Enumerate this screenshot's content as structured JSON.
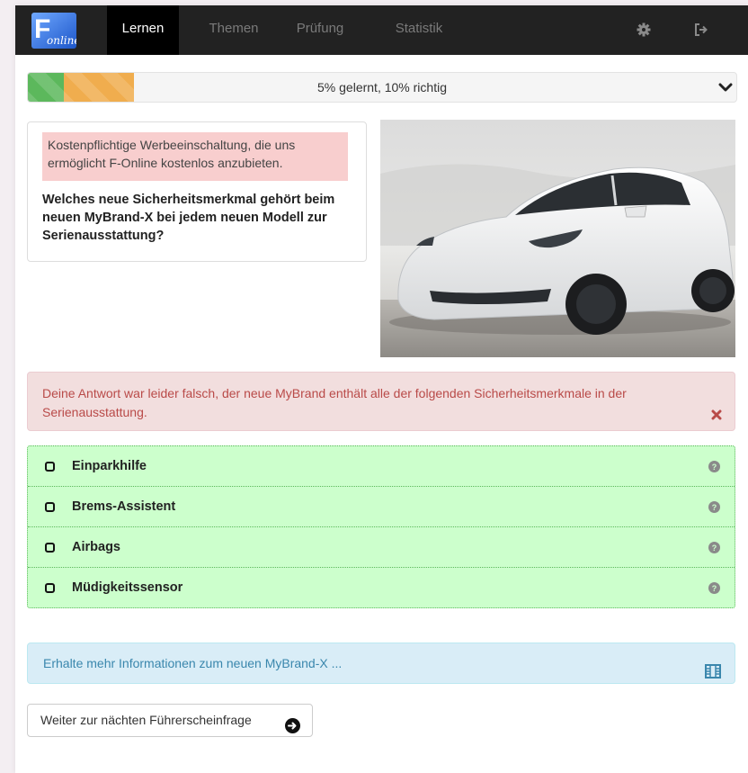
{
  "nav": {
    "logo_letter": "F",
    "logo_sub": "online",
    "items": [
      {
        "label": "Lernen",
        "active": true
      },
      {
        "label": "Themen",
        "active": false
      },
      {
        "label": "Prüfung",
        "active": false
      },
      {
        "label": "Statistik",
        "active": false
      }
    ],
    "icons": [
      "gear-icon",
      "sign-out-icon"
    ]
  },
  "progress": {
    "text": "5% gelernt, 10% richtig",
    "learned_percent": 5,
    "correct_percent": 10
  },
  "question": {
    "ad_text": "Kostenpflichtige Werbeeinschaltung, die uns ermöglicht F-Online kostenlos anzubieten.",
    "text": "Welches neue Sicherheitsmerkmal gehört beim neuen MyBrand-X bei jedem neuen Modell zur Serienausstattung?"
  },
  "feedback": {
    "text": "Deine Antwort war leider falsch, der neue MyBrand enthält alle der folgenden Sicherheitsmerkmale in der Serienausstattung."
  },
  "answers": [
    {
      "label": "Einparkhilfe"
    },
    {
      "label": "Brems-Assistent"
    },
    {
      "label": "Airbags"
    },
    {
      "label": "Müdigkeitssensor"
    }
  ],
  "info": {
    "text": "Erhalte mehr Informationen zum neuen MyBrand-X ..."
  },
  "next_button": {
    "label": "Weiter zur nächten Führerscheinfrage"
  },
  "colors": {
    "navbar": "#222222",
    "progress_green": "#5cb85c",
    "progress_orange": "#f0ad4e",
    "ad_bg": "#f8cece",
    "danger_bg": "#f2dede",
    "danger_text": "#b94a48",
    "answer_bg": "#ccffcc",
    "info_bg": "#d9edf7",
    "info_text": "#3a87ad"
  }
}
